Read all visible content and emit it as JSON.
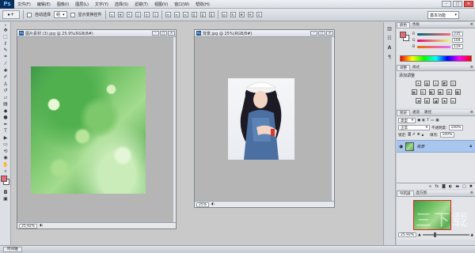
{
  "app": {
    "logo": "Ps"
  },
  "menu": [
    "文件(F)",
    "编辑(E)",
    "图像(I)",
    "图层(L)",
    "文字(Y)",
    "选择(S)",
    "滤镜(T)",
    "视图(V)",
    "窗口(W)",
    "帮助(H)"
  ],
  "window_buttons": {
    "minimize": "–",
    "maximize": "□",
    "close": "✕"
  },
  "options_bar": {
    "tool_glyph": "▸+",
    "auto_select_label": "自动选择",
    "auto_select_target": "组",
    "show_transform_label": "显示变换控件",
    "workspace": "基本功能"
  },
  "documents": [
    {
      "title": "图片素材 (3).jpg @ 25.9%(RGB/8#)",
      "zoom": "25.92%"
    },
    {
      "title": "背景.jpg @ 25%(RGB/8#)",
      "zoom": "25%"
    }
  ],
  "color_panel": {
    "tabs": [
      "颜色",
      "色板"
    ],
    "sliders": [
      {
        "label": "R",
        "value": "235"
      },
      {
        "label": "G",
        "value": "104"
      },
      {
        "label": "B",
        "value": "119"
      }
    ],
    "fg_color": "#eb6877"
  },
  "adjustments_panel": {
    "tabs": [
      "调整",
      "样式"
    ],
    "title": "添加调整"
  },
  "layers_panel": {
    "tabs": [
      "图层",
      "通道",
      "路径"
    ],
    "kind": "类型",
    "blend_mode": "正常",
    "opacity_label": "不透明度:",
    "opacity": "100%",
    "lock_label": "锁定:",
    "fill_label": "填充:",
    "fill": "100%",
    "layer_name": "背景"
  },
  "navigator_panel": {
    "tabs": [
      "导航器",
      "直方图"
    ],
    "zoom": "25.92%"
  },
  "bottom_bar": {
    "tab": "时间轴"
  },
  "watermark": {
    "text": "三下载"
  }
}
